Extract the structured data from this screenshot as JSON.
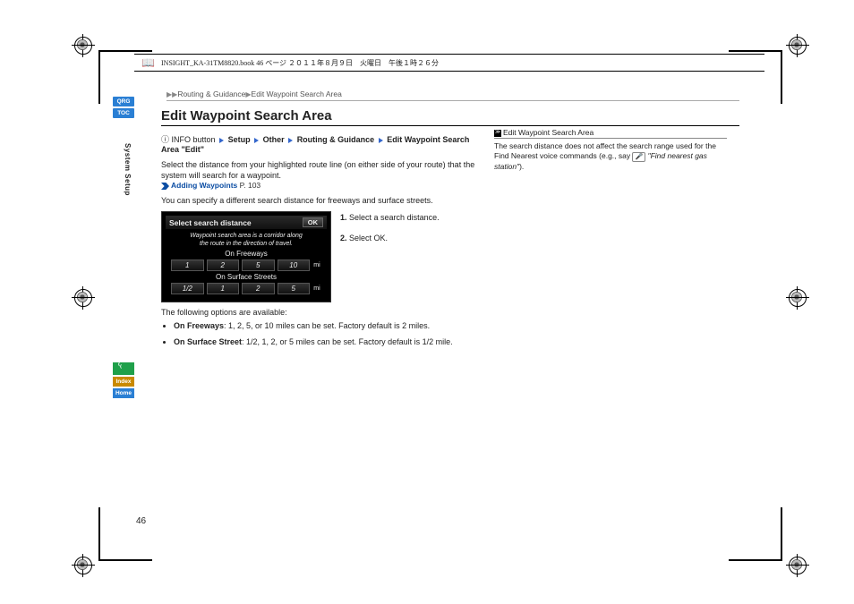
{
  "print_header": "INSIGHT_KA-31TM8820.book  46 ページ  ２０１１年８月９日　火曜日　午後１時２６分",
  "breadcrumb": {
    "a": "Routing & Guidance",
    "b": "Edit Waypoint Search Area"
  },
  "title": "Edit Waypoint Search Area",
  "side_tab": "System Setup",
  "nav": {
    "qrg": "QRG",
    "toc": "TOC",
    "voice": "",
    "index": "Index",
    "home": "Home"
  },
  "info_path": {
    "icon": "ⓘ",
    "prefix": "INFO button",
    "p1": "Setup",
    "p2": "Other",
    "p3": "Routing & Guidance",
    "p4": "Edit Waypoint Search Area \"Edit\""
  },
  "desc1": "Select the distance from your highlighted route line (on either side of your route) that the system will search for a waypoint.",
  "link": {
    "label": "Adding Waypoints",
    "page": "P. 103"
  },
  "desc2": "You can specify a different search distance for freeways and surface streets.",
  "device": {
    "title": "Select search distance",
    "ok": "OK",
    "caption1": "Waypoint search area is a corridor along",
    "caption2": "the route in the direction of travel.",
    "label_freeways": "On Freeways",
    "freeway_opts": [
      "1",
      "2",
      "5",
      "10"
    ],
    "freeway_unit": "mi",
    "label_surface": "On Surface Streets",
    "surface_opts": [
      "1/2",
      "1",
      "2",
      "5"
    ],
    "surface_unit": "mi"
  },
  "steps": {
    "s1n": "1.",
    "s1t": "Select a search distance.",
    "s2n": "2.",
    "s2t": "Select OK."
  },
  "options_head": "The following options are available:",
  "opt1_label": "On Freeways",
  "opt1_text": ": 1, 2, 5, or 10 miles can be set. Factory default is 2 miles.",
  "opt2_label": "On Surface Street",
  "opt2_text": ": 1/2, 1, 2, or 5 miles can be set. Factory default is 1/2 mile.",
  "side": {
    "head": "Edit Waypoint Search Area",
    "note1": "The search distance does not affect the search range used for the Find Nearest voice commands (e.g., say ",
    "voice_icon": "🎤",
    "note2": "\"Find nearest gas station\"",
    "note3": ")."
  },
  "page_number": "46"
}
